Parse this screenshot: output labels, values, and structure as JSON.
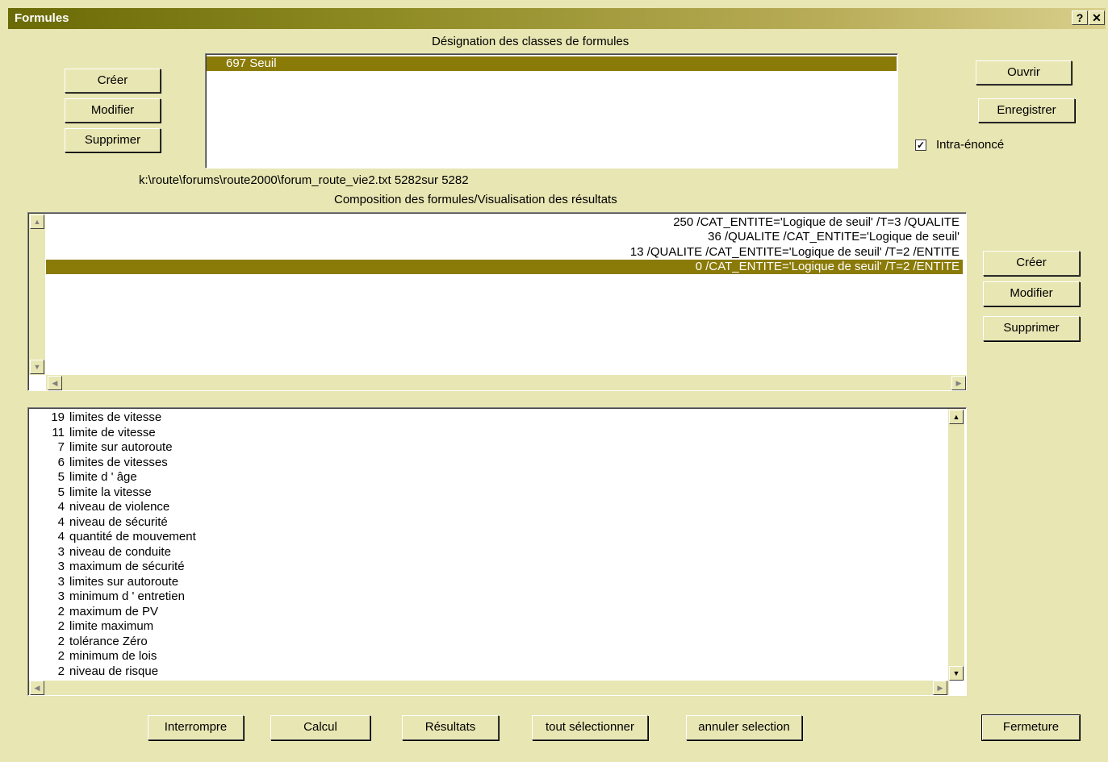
{
  "window": {
    "title": "Formules",
    "help_label": "?",
    "close_label": "✕"
  },
  "top": {
    "heading": "Désignation des classes de formules",
    "buttons": {
      "creer": "Créer",
      "modifier": "Modifier",
      "supprimer": "Supprimer"
    },
    "list": [
      {
        "label": "697  Seuil"
      }
    ],
    "right_buttons": {
      "ouvrir": "Ouvrir",
      "enregistrer": "Enregistrer"
    },
    "checkbox": {
      "label": "Intra-énoncé",
      "checked": true
    }
  },
  "path": "k:\\route\\forums\\route2000\\forum_route_vie2.txt 5282sur 5282",
  "composition": {
    "heading": "Composition des formules/Visualisation des résultats",
    "rows": [
      "250  /CAT_ENTITE='Logique de seuil' /T=3 /QUALITE",
      "36  /QUALITE /CAT_ENTITE='Logique de seuil'",
      "13  /QUALITE /CAT_ENTITE='Logique de seuil' /T=2 /ENTITE",
      "0  /CAT_ENTITE='Logique de seuil' /T=2 /ENTITE"
    ],
    "selected_index": 3,
    "buttons": {
      "creer": "Créer",
      "modifier": "Modifier",
      "supprimer": "Supprimer"
    }
  },
  "results": [
    {
      "count": "19",
      "text": "limites de vitesse"
    },
    {
      "count": "11",
      "text": "limite de vitesse"
    },
    {
      "count": "7",
      "text": "limite sur autoroute"
    },
    {
      "count": "6",
      "text": "limites de vitesses"
    },
    {
      "count": "5",
      "text": "limite d ' âge"
    },
    {
      "count": "5",
      "text": "limite la vitesse"
    },
    {
      "count": "4",
      "text": "niveau de violence"
    },
    {
      "count": "4",
      "text": "niveau de sécurité"
    },
    {
      "count": "4",
      "text": "quantité de mouvement"
    },
    {
      "count": "3",
      "text": "niveau de conduite"
    },
    {
      "count": "3",
      "text": "maximum de sécurité"
    },
    {
      "count": "3",
      "text": "limites sur autoroute"
    },
    {
      "count": "3",
      "text": "minimum d ' entretien"
    },
    {
      "count": "2",
      "text": "maximum de PV"
    },
    {
      "count": "2",
      "text": "limite maximum"
    },
    {
      "count": "2",
      "text": "tolérance Zéro"
    },
    {
      "count": "2",
      "text": "minimum de lois"
    },
    {
      "count": "2",
      "text": "niveau de risque"
    }
  ],
  "bottom_buttons": {
    "interrompre": "Interrompre",
    "calcul": "Calcul",
    "resultats": "Résultats",
    "tout_selectionner": "tout sélectionner",
    "annuler_selection": "annuler selection",
    "fermeture": "Fermeture"
  },
  "colors": {
    "face": "#e8e6b3",
    "selection": "#8a7a07",
    "title_start": "#6a6a06",
    "title_end": "#d9cf8c"
  }
}
